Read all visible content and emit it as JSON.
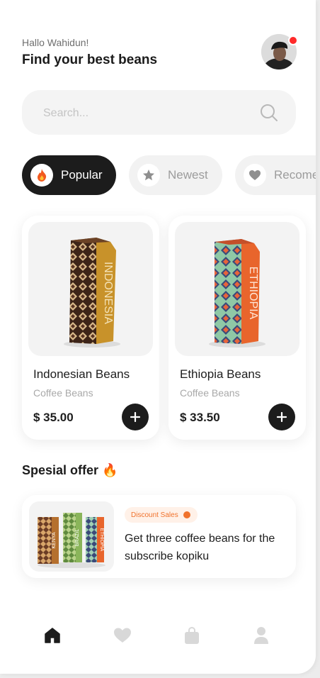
{
  "header": {
    "greeting": "Hallo Wahidun!",
    "title": "Find your best beans",
    "notification_color": "#ff2a2a"
  },
  "search": {
    "placeholder": "Search...",
    "value": "",
    "icon": "search-icon"
  },
  "filters": [
    {
      "label": "Popular",
      "icon": "fire-icon",
      "active": true
    },
    {
      "label": "Newest",
      "icon": "star-icon",
      "active": false
    },
    {
      "label": "Recome",
      "icon": "heart-icon",
      "active": false
    }
  ],
  "products": [
    {
      "name": "Indonesian Beans",
      "category": "Coffee Beans",
      "price": "$ 35.00",
      "bag_label": "INDONESIA"
    },
    {
      "name": "Ethiopia Beans",
      "category": "Coffee Beans",
      "price": "$ 33.50",
      "bag_label": "ETHIOPIA"
    }
  ],
  "offer": {
    "section_title": "Spesial offer 🔥",
    "badge": "Discount Sales",
    "text": "Get three coffee beans for the subscribe kopiku",
    "bag_labels": [
      "KENYA",
      "BRAZIL",
      "ETHIOPIA"
    ]
  },
  "nav": [
    {
      "icon": "home-icon",
      "active": true
    },
    {
      "icon": "heart-icon",
      "active": false
    },
    {
      "icon": "bag-icon",
      "active": false
    },
    {
      "icon": "profile-icon",
      "active": false
    }
  ],
  "colors": {
    "accent_dark": "#1c1c1c",
    "badge_text": "#f0722c",
    "badge_bg": "#fff1e8"
  }
}
